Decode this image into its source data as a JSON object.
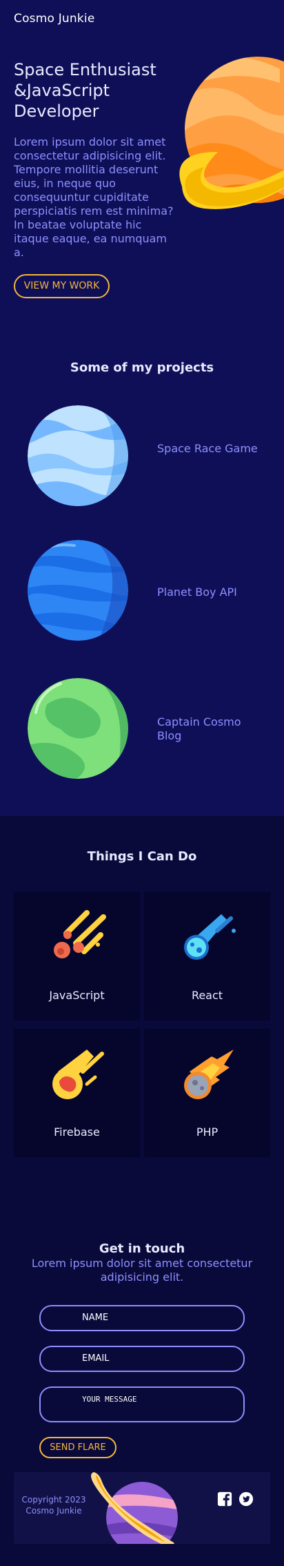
{
  "brand": "Cosmo Junkie",
  "hero": {
    "title": "Space Enthusiast &JavaScript Developer",
    "text": "Lorem ipsum dolor sit amet consectetur adipisicing elit. Tempore mollitia deserunt eius, in neque quo consequuntur cupiditate perspiciatis rem est minima? In beatae voluptate hic itaque eaque, ea numquam a.",
    "cta": "VIEW MY WORK"
  },
  "projects": {
    "title": "Some of my projects",
    "items": [
      {
        "label": "Space Race Game",
        "icon": "light-blue-planet-icon"
      },
      {
        "label": "Planet Boy API",
        "icon": "blue-planet-icon"
      },
      {
        "label": "Captain Cosmo Blog",
        "icon": "green-planet-icon"
      }
    ]
  },
  "skills": {
    "title": "Things I Can Do",
    "items": [
      {
        "label": "JavaScript",
        "icon": "yellow-meteor-icon"
      },
      {
        "label": "React",
        "icon": "blue-comet-icon"
      },
      {
        "label": "Firebase",
        "icon": "red-meteor-icon"
      },
      {
        "label": "PHP",
        "icon": "gray-meteor-icon"
      }
    ]
  },
  "contact": {
    "title": "Get in touch",
    "subtitle": "Lorem ipsum dolor sit amet consectetur adipisicing elit.",
    "name_placeholder": "NAME",
    "email_placeholder": "EMAIL",
    "message_placeholder": "YOUR MESSAGE",
    "submit": "SEND FLARE"
  },
  "footer": {
    "copyright": "Copyright 2023 Cosmo Junkie",
    "social": [
      "facebook-icon",
      "twitter-icon"
    ]
  },
  "colors": {
    "hero_bg": "#0f0f57",
    "accent": "#f4b63e",
    "text_muted": "#8e90ff",
    "card_bg": "#06062d"
  }
}
